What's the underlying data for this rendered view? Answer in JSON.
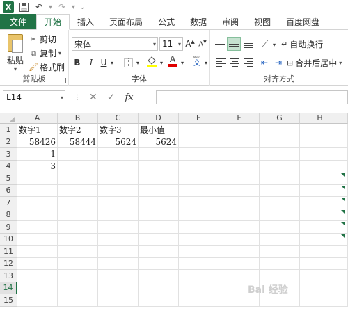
{
  "tabs": [
    "文件",
    "开始",
    "插入",
    "页面布局",
    "公式",
    "数据",
    "审阅",
    "视图",
    "百度网盘"
  ],
  "clipboard": {
    "paste": "粘贴",
    "cut": "剪切",
    "copy": "复制",
    "format_painter": "格式刷",
    "label": "剪贴板"
  },
  "font": {
    "name": "宋体",
    "size": "11",
    "bold": "B",
    "italic": "I",
    "underline": "U",
    "font_color_glyph": "A",
    "label": "字体"
  },
  "alignment": {
    "wrap_text": "自动换行",
    "merge_center": "合并后居中",
    "label": "对齐方式"
  },
  "formula_bar": {
    "name_box": "L14",
    "fx": "fx",
    "cancel": "✕",
    "enter": "✓",
    "content": ""
  },
  "sheet": {
    "columns": [
      "A",
      "B",
      "C",
      "D",
      "E",
      "F",
      "G",
      "H"
    ],
    "rows": [
      "1",
      "2",
      "3",
      "4",
      "5",
      "6",
      "7",
      "8",
      "9",
      "10",
      "11",
      "12",
      "13",
      "14",
      "15"
    ],
    "selected_row": "14",
    "cells": {
      "A1": "数字1",
      "B1": "数字2",
      "C1": "数字3",
      "D1": "最小值",
      "A2": "58426",
      "B2": "58444",
      "C2": "5624",
      "D2": "5624",
      "A3": "1",
      "A4": "3"
    }
  },
  "colors": {
    "accent": "#217346",
    "header_bg": "#f0f0f0",
    "gridline": "#e1e1e1"
  }
}
